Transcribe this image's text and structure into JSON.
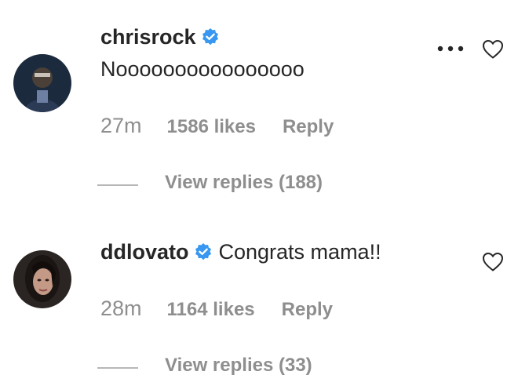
{
  "comments": [
    {
      "username": "chrisrock",
      "verified": true,
      "text": "Noooooooooooooooo",
      "time": "27m",
      "likes": "1586 likes",
      "reply_label": "Reply",
      "view_replies": "View replies (188)",
      "avatar_icon": "avatar-chrisrock"
    },
    {
      "username": "ddlovato",
      "verified": true,
      "text": "Congrats mama!!",
      "time": "28m",
      "likes": "1164 likes",
      "reply_label": "Reply",
      "view_replies": "View replies (33)",
      "avatar_icon": "avatar-ddlovato"
    }
  ],
  "colors": {
    "primary_text": "#262626",
    "secondary_text": "#8e8e8e",
    "verified_blue": "#3897f0"
  },
  "icons": [
    "verified-badge-icon",
    "more-options-icon",
    "heart-icon"
  ]
}
